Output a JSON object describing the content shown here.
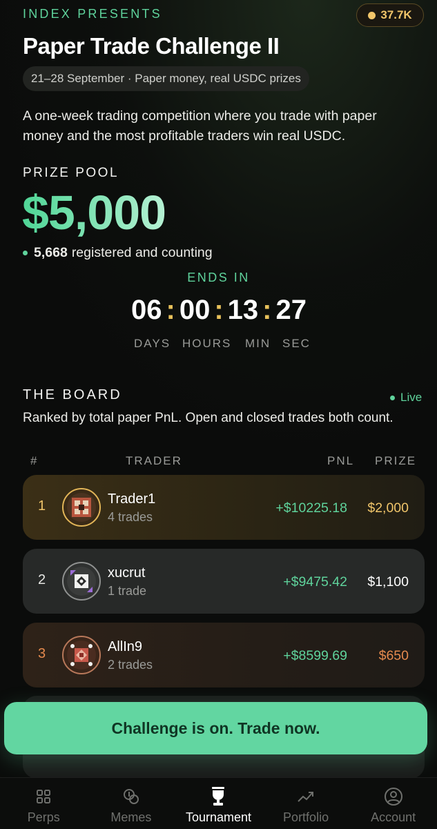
{
  "header": {
    "presents": "INDEX PRESENTS",
    "coin_balance": "37.7K",
    "title": "Paper Trade Challenge II",
    "date_pill": "21–28 September · Paper money, real USDC prizes",
    "description": "A one-week trading competition where you trade with paper money and the most profitable traders win real USDC."
  },
  "prize": {
    "label": "PRIZE POOL",
    "amount": "$5,000",
    "registered_count": "5,668",
    "registered_text": "registered and counting"
  },
  "countdown": {
    "label": "ENDS IN",
    "days": "06",
    "hours": "00",
    "minutes": "13",
    "seconds": "27",
    "separator": ":",
    "labels": {
      "days": "DAYS",
      "hours": "HOURS",
      "min": "MIN",
      "sec": "SEC"
    }
  },
  "board": {
    "title": "THE BOARD",
    "live": "Live",
    "description": "Ranked by total paper PnL. Open and closed trades both count.",
    "columns": {
      "rank": "#",
      "trader": "TRADER",
      "pnl": "PNL",
      "prize": "PRIZE"
    },
    "rows": [
      {
        "rank": "1",
        "name": "Trader1",
        "trades": "4 trades",
        "pnl": "+$10225.18",
        "prize": "$2,000",
        "prize_color": "#f0c56a"
      },
      {
        "rank": "2",
        "name": "xucrut",
        "trades": "1 trade",
        "pnl": "+$9475.42",
        "prize": "$1,100",
        "prize_color": "#ffffff"
      },
      {
        "rank": "3",
        "name": "AllIn9",
        "trades": "2 trades",
        "pnl": "+$8599.69",
        "prize": "$650",
        "prize_color": "#e58a4e"
      }
    ]
  },
  "cta": {
    "label": "Challenge is on. Trade now."
  },
  "nav": {
    "items": [
      {
        "label": "Perps",
        "icon": "grid-icon"
      },
      {
        "label": "Memes",
        "icon": "coins-icon"
      },
      {
        "label": "Tournament",
        "icon": "trophy-icon"
      },
      {
        "label": "Portfolio",
        "icon": "trend-up-icon"
      },
      {
        "label": "Account",
        "icon": "user-circle-icon"
      }
    ]
  },
  "colors": {
    "accent_green": "#5fd39c",
    "gold": "#f0c56a",
    "bronze": "#e58a4e",
    "cta_bg": "#62d6a1"
  }
}
